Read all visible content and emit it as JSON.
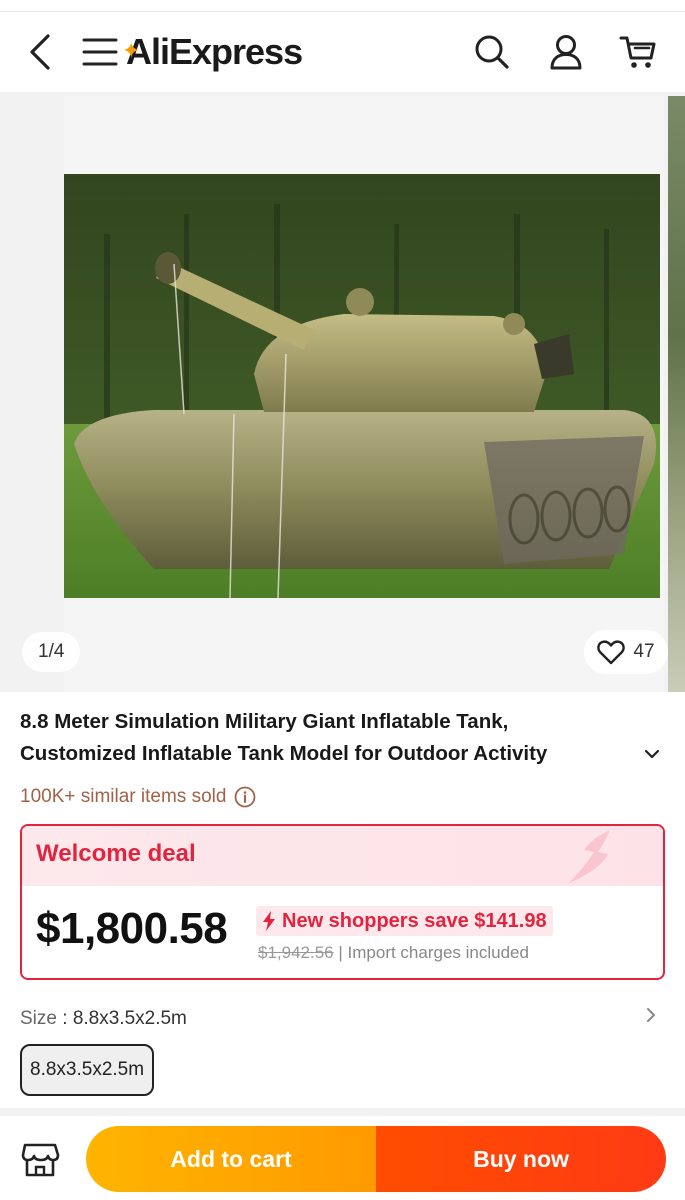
{
  "header": {
    "logo_text": "AliExpress",
    "icons": [
      "back-icon",
      "menu-icon",
      "search-icon",
      "account-icon",
      "cart-icon"
    ]
  },
  "gallery": {
    "counter": "1/4",
    "wishlist_count": "47"
  },
  "product": {
    "title_line1": "8.8 Meter Simulation Military Giant Inflatable Tank,",
    "title_line2": "Customized Inflatable Tank Model for Outdoor Activity",
    "sold_text": "100K+ similar items sold"
  },
  "deal": {
    "label": "Welcome deal",
    "price": "$1,800.58",
    "save_text": "New shoppers save $141.98",
    "original_price": "$1,942.56",
    "separator": "|",
    "import_text": "Import charges included"
  },
  "size": {
    "label": "Size",
    "separator": " : ",
    "selected": "8.8x3.5x2.5m",
    "options": [
      "8.8x3.5x2.5m"
    ]
  },
  "actions": {
    "add_to_cart": "Add to cart",
    "buy_now": "Buy now"
  },
  "colors": {
    "accent_red": "#e4233f",
    "add_to_cart": "#ffa800",
    "buy_now": "#ff4500"
  }
}
